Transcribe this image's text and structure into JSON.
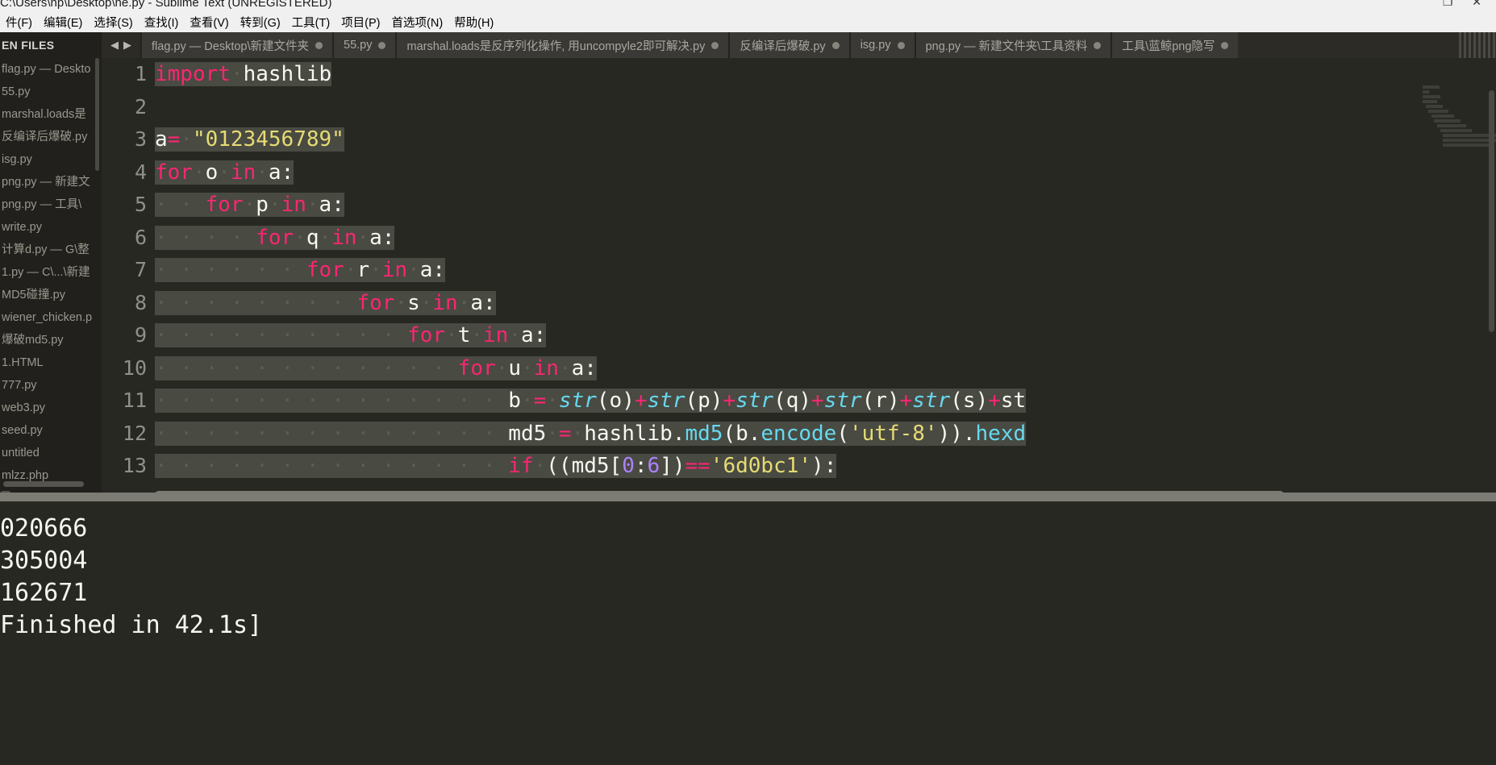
{
  "window": {
    "title": "C:\\Users\\hp\\Desktop\\he.py - Sublime Text (UNREGISTERED)",
    "controls": "❐  ✕"
  },
  "menubar": {
    "items": [
      {
        "label": "件(F)"
      },
      {
        "label": "编辑(E)"
      },
      {
        "label": "选择(S)"
      },
      {
        "label": "查找(I)"
      },
      {
        "label": "查看(V)"
      },
      {
        "label": "转到(G)"
      },
      {
        "label": "工具(T)"
      },
      {
        "label": "项目(P)"
      },
      {
        "label": "首选项(N)"
      },
      {
        "label": "帮助(H)"
      }
    ]
  },
  "sidebar": {
    "header": "EN FILES",
    "items": [
      {
        "label": "flag.py — Deskto"
      },
      {
        "label": "55.py"
      },
      {
        "label": "marshal.loads是"
      },
      {
        "label": "反编译后爆破.py"
      },
      {
        "label": "isg.py"
      },
      {
        "label": "png.py — 新建文"
      },
      {
        "label": "png.py — 工具\\"
      },
      {
        "label": "write.py"
      },
      {
        "label": "计算d.py — G\\整"
      },
      {
        "label": "1.py — C\\...\\新建"
      },
      {
        "label": "MD5碰撞.py"
      },
      {
        "label": "wiener_chicken.p"
      },
      {
        "label": "爆破md5.py"
      },
      {
        "label": "1.HTML"
      },
      {
        "label": "777.py"
      },
      {
        "label": "web3.py"
      },
      {
        "label": "seed.py"
      },
      {
        "label": "untitled"
      },
      {
        "label": "mlzz.php"
      }
    ]
  },
  "tabbar": {
    "prev_arrow": "◀",
    "next_arrow": "▶",
    "tabs": [
      {
        "label": "flag.py — Desktop\\新建文件夹",
        "modified": true
      },
      {
        "label": "55.py",
        "modified": true
      },
      {
        "label": "marshal.loads是反序列化操作, 用uncompyle2即可解决.py",
        "modified": true
      },
      {
        "label": "反编译后爆破.py",
        "modified": true
      },
      {
        "label": "isg.py",
        "modified": true
      },
      {
        "label": "png.py — 新建文件夹\\工具资料",
        "modified": true
      },
      {
        "label": "工具\\蓝鲸png隐写",
        "modified": true
      }
    ]
  },
  "editor": {
    "line_numbers": [
      "1",
      "2",
      "3",
      "4",
      "5",
      "6",
      "7",
      "8",
      "9",
      "10",
      "11",
      "12",
      "13"
    ],
    "code": [
      "import hashlib",
      "",
      "a= \"0123456789\"",
      "for o in a:",
      "    for p in a:",
      "        for q in a:",
      "            for r in a:",
      "                for s in a:",
      "                    for t in a:",
      "                        for u in a:",
      "                            b = str(o)+str(p)+str(q)+str(r)+str(s)+st",
      "                            md5 = hashlib.md5(b.encode('utf-8')).hexd",
      "                            if ((md5[0:6])=='6d0bc1'):"
    ],
    "string_literal_a": "\"0123456789\"",
    "hash_prefix": "'6d0bc1'",
    "encoding": "'utf-8'",
    "slice_start": "0",
    "slice_end": "6"
  },
  "console": {
    "lines": [
      "020666",
      "305004",
      "162671",
      "Finished in 42.1s]"
    ]
  },
  "colors": {
    "background": "#272822",
    "sidebar_bg": "#21201c",
    "tab_active_bg": "#3a3935",
    "keyword": "#f92672",
    "string": "#e6db74",
    "function": "#66d9ef",
    "number": "#ae81ff",
    "plain": "#f8f8f2",
    "selection": "#494a42",
    "titlebar": "#f0f0f0"
  }
}
